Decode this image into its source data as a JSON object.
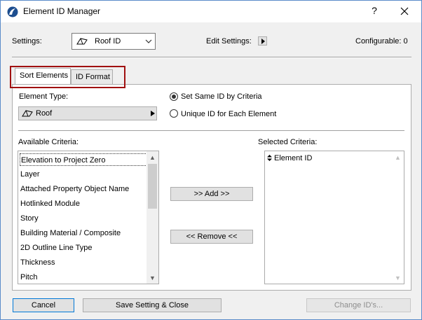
{
  "window": {
    "title": "Element ID Manager",
    "help_label": "?"
  },
  "settings": {
    "label": "Settings:",
    "value": "Roof ID",
    "edit_label": "Edit Settings:",
    "configurable": "Configurable: 0"
  },
  "tabs": [
    {
      "label": "Sort Elements"
    },
    {
      "label": "ID Format"
    }
  ],
  "element_type": {
    "label": "Element Type:",
    "value": "Roof"
  },
  "options": {
    "same_id": "Set Same ID by Criteria",
    "unique_id": "Unique ID for Each Element",
    "selected": "same_id"
  },
  "available": {
    "label": "Available Criteria:",
    "items": [
      "Elevation to Project Zero",
      "Layer",
      "Attached Property Object Name",
      "Hotlinked Module",
      "Story",
      "Building Material / Composite",
      "2D Outline Line Type",
      "Thickness",
      "Pitch"
    ]
  },
  "selected_criteria": {
    "label": "Selected Criteria:",
    "items": [
      "Element ID"
    ]
  },
  "buttons": {
    "add": ">> Add >>",
    "remove": "<< Remove <<",
    "cancel": "Cancel",
    "save": "Save Setting & Close",
    "change": "Change ID's..."
  },
  "colors": {
    "highlight": "#a01010",
    "accent": "#0078d7"
  }
}
